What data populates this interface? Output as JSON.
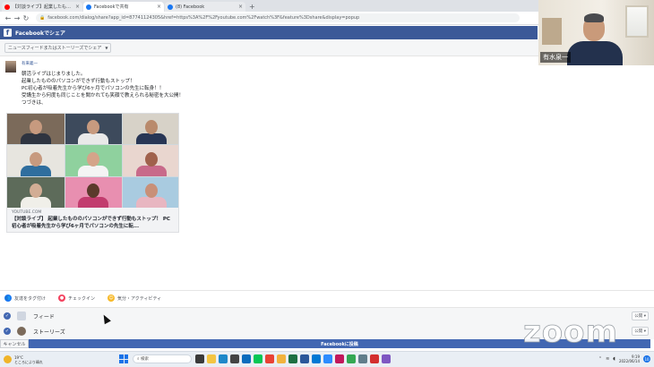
{
  "browser": {
    "tabs": [
      {
        "title": "【対談ライブ】起業したもののパソコン",
        "favicon_color": "#ff0000",
        "active": false
      },
      {
        "title": "Facebookで共有",
        "favicon_color": "#1877f2",
        "active": true
      },
      {
        "title": "(8) Facebook",
        "favicon_color": "#1877f2",
        "active": false
      }
    ],
    "url": "facebook.com/dialog/share?app_id=87741124305&href=https%3A%2F%2Fyoutube.com%2Fwatch%3F&feature%3Dshare&display=popup"
  },
  "fb": {
    "header_title": "Facebookでシェア",
    "share_target": "ニュースフィードまたはストーリーズでシェア",
    "author_name": "有来義一",
    "post_text": "朝活ライブはじまりました。\n起業したもののパソコンができず行動もストップ！\nPC初心者が吸着先生から学び6ヶ月でパソコンの先生に転身！！\n受講生から何度も同じことを聞かれても笑顔で教えられる秘密を大公開！\nつづきは、",
    "card_domain": "YOUTUBE.COM",
    "card_title": "【対談ライブ】 起業したもののパソコンができず行動もストップ！ PC初心者が吸着先生から学び6ヶ月でパソコンの先生に転..."
  },
  "options": {
    "tag_friends": "友達をタグ付け",
    "checkin": "チェックイン",
    "feeling": "気分・アクティビティ"
  },
  "destinations": {
    "feed_label": "フィード",
    "stories_label": "ストーリーズ",
    "privacy": "公開 ▾"
  },
  "buttons": {
    "cancel": "キャンセル",
    "post": "Facebookに投稿"
  },
  "taskbar": {
    "weather_temp": "19°C",
    "weather_desc": "ところにより晴れ",
    "search_placeholder": "検索",
    "time": "9:19",
    "date": "2022/06/14",
    "notifications": "10"
  },
  "zoom": {
    "participant_name": "有水泉一",
    "logo": "zoom"
  }
}
